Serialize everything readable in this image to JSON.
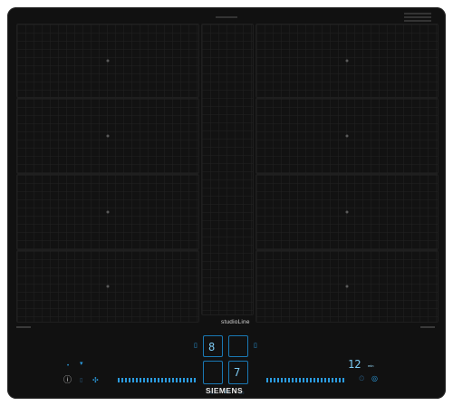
{
  "brand": {
    "series": "studioLine",
    "manufacturer": "SIEMENS"
  },
  "display": {
    "left_power_level": "8",
    "right_power_level": "7",
    "timer_value": "12",
    "timer_unit": "min"
  },
  "colors": {
    "surface": "#111111",
    "display_accent": "#2b9ce0",
    "text_light": "#d8d8d8"
  },
  "icons": {
    "power": "power-icon",
    "fan": "fan-icon",
    "lock": "lock-icon",
    "timer": "timer-icon"
  }
}
